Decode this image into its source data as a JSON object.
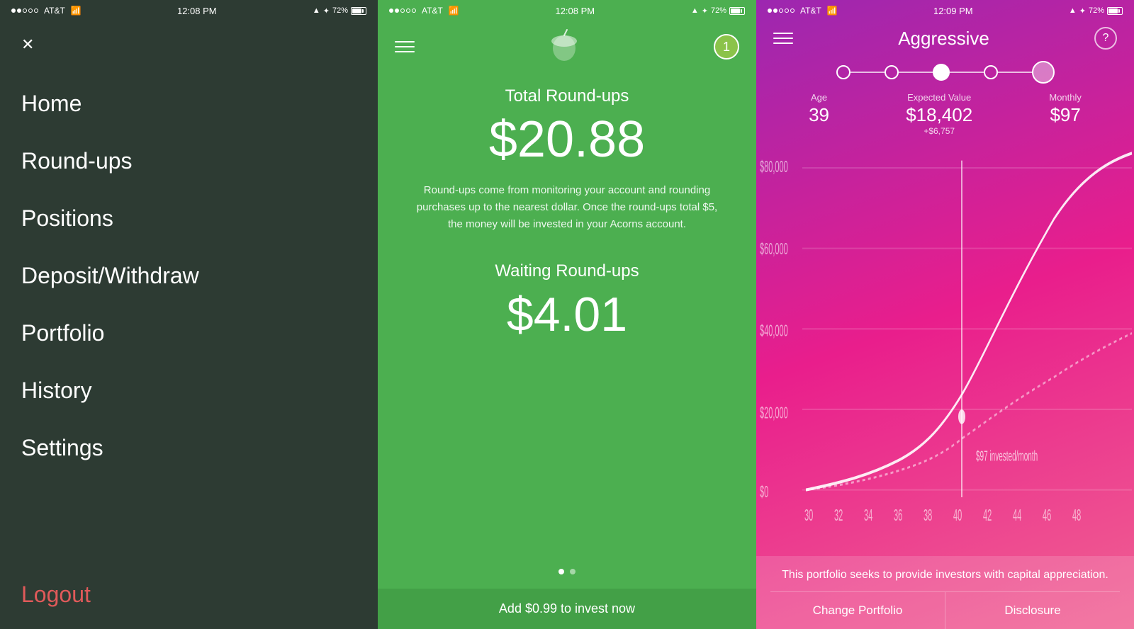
{
  "panel1": {
    "status": {
      "time": "12:08 PM",
      "carrier": "AT&T",
      "battery": "72%"
    },
    "close_label": "✕",
    "menu_items": [
      {
        "label": "Home",
        "id": "home"
      },
      {
        "label": "Round-ups",
        "id": "roundups"
      },
      {
        "label": "Positions",
        "id": "positions"
      },
      {
        "label": "Deposit/Withdraw",
        "id": "deposit"
      },
      {
        "label": "Portfolio",
        "id": "portfolio"
      },
      {
        "label": "History",
        "id": "history"
      },
      {
        "label": "Settings",
        "id": "settings"
      }
    ],
    "logout_label": "Logout"
  },
  "panel2": {
    "status": {
      "time": "12:08 PM",
      "carrier": "AT&T",
      "battery": "72%"
    },
    "notification_count": "1",
    "total_roundups_label": "Total Round-ups",
    "total_amount": "$20.88",
    "description": "Round-ups come from monitoring your account and rounding purchases up to the nearest dollar.  Once the round-ups total $5, the money will be invested in your Acorns account.",
    "waiting_label": "Waiting Round-ups",
    "waiting_amount": "$4.01",
    "footer_label": "Add $0.99 to invest now"
  },
  "panel3": {
    "status": {
      "time": "12:09 PM",
      "carrier": "AT&T",
      "battery": "72%"
    },
    "title": "Aggressive",
    "progress_steps": 5,
    "selected_step": 3,
    "stats": {
      "age_label": "Age",
      "age_value": "39",
      "ev_label": "Expected Value",
      "ev_value": "$18,402",
      "ev_sub": "+$6,757",
      "monthly_label": "Monthly",
      "monthly_value": "$97"
    },
    "chart": {
      "y_labels": [
        "$80,000",
        "$60,000",
        "$40,000",
        "$20,000",
        "$0"
      ],
      "x_labels": [
        "30",
        "32",
        "34",
        "36",
        "38",
        "40",
        "42",
        "44",
        "46",
        "48"
      ],
      "line_label": "$97 invested/month"
    },
    "description": "This portfolio seeks to provide investors with capital appreciation.",
    "change_portfolio_label": "Change Portfolio",
    "disclosure_label": "Disclosure"
  }
}
